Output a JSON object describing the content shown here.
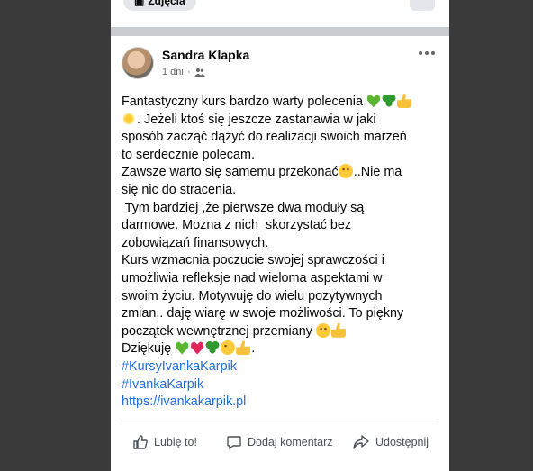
{
  "previous_post": {
    "photos_button_label": "Zdjęcia"
  },
  "post": {
    "author": "Sandra Klapka",
    "timestamp": "1 dni",
    "meta_separator": "·",
    "privacy_icon": "friends-icon",
    "more_icon": "more-dots-icon",
    "lines": [
      {
        "parts": [
          {
            "t": "Fantastyczny kurs bardzo warty polecenia "
          },
          {
            "e": "green-heart"
          },
          {
            "e": "clover"
          },
          {
            "e": "thumbs-up"
          }
        ]
      },
      {
        "parts": [
          {
            "e": "sun"
          },
          {
            "t": ". Jeżeli ktoś się jeszcze zastanawia w jaki"
          }
        ]
      },
      {
        "parts": [
          {
            "t": "sposób zacząć dążyć do realizacji swoich marzeń"
          }
        ]
      },
      {
        "parts": [
          {
            "t": "to serdecznie polecam."
          }
        ]
      },
      {
        "parts": [
          {
            "t": "Zawsze warto się samemu przekonać"
          },
          {
            "e": "smile"
          },
          {
            "t": "..Nie ma"
          }
        ]
      },
      {
        "parts": [
          {
            "t": "się nic do stracenia."
          }
        ]
      },
      {
        "parts": [
          {
            "t": " Tym bardziej ,że pierwsze dwa moduły są"
          }
        ]
      },
      {
        "parts": [
          {
            "t": "darmowe. Można z nich  skorzystać bez"
          }
        ]
      },
      {
        "parts": [
          {
            "t": "zobowiązań finansowych."
          }
        ]
      },
      {
        "parts": [
          {
            "t": "Kurs wzmacnia poczucie swojej sprawczości i"
          }
        ]
      },
      {
        "parts": [
          {
            "t": "umożliwia refleksje nad wieloma aspektami w"
          }
        ]
      },
      {
        "parts": [
          {
            "t": "swoim życiu. Motywuję do wielu pozytywnych"
          }
        ]
      },
      {
        "parts": [
          {
            "t": "zmian,. daję wiarę w swoje możliwości. To piękny"
          }
        ]
      },
      {
        "parts": [
          {
            "t": "początek wewnętrznej przemiany "
          },
          {
            "e": "smile"
          },
          {
            "e": "thumbs-up"
          }
        ]
      },
      {
        "parts": [
          {
            "t": "Dziękuję "
          },
          {
            "e": "green-heart"
          },
          {
            "e": "red-heart"
          },
          {
            "e": "clover"
          },
          {
            "e": "wink"
          },
          {
            "e": "thumbs-up"
          },
          {
            "t": "."
          }
        ]
      },
      {
        "parts": [
          {
            "link": "#KursyIvankaKarpik"
          }
        ]
      },
      {
        "parts": [
          {
            "link": "#IvankaKarpik"
          }
        ]
      },
      {
        "parts": [
          {
            "link": "https://ivankakarpik.pl"
          }
        ]
      }
    ]
  },
  "actions": {
    "like_label": "Lubię to!",
    "comment_label": "Dodaj komentarz",
    "share_label": "Udostępnij"
  },
  "colors": {
    "link": "#216fdb",
    "text": "#050505",
    "meta": "#65676b"
  }
}
